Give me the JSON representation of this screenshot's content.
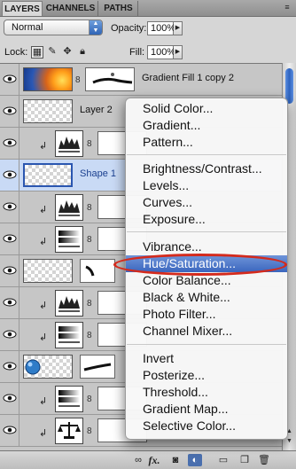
{
  "tabs": [
    {
      "label": "LAYERS",
      "active": true
    },
    {
      "label": "CHANNELS",
      "active": false
    },
    {
      "label": "PATHS",
      "active": false
    }
  ],
  "blend_mode": "Normal",
  "opacity": {
    "label": "Opacity:",
    "value": "100%"
  },
  "lock": {
    "label": "Lock:"
  },
  "fill": {
    "label": "Fill:",
    "value": "100%"
  },
  "layers": [
    {
      "type": "gradient-fill",
      "name": "Gradient Fill 1 copy 2"
    },
    {
      "type": "raster",
      "name": "Layer 2"
    },
    {
      "type": "adjustment",
      "name": ""
    },
    {
      "type": "shape",
      "name": "Shape 1",
      "selected": true
    },
    {
      "type": "adjustment",
      "name": ""
    },
    {
      "type": "adjustment",
      "name": ""
    },
    {
      "type": "raster",
      "name": ""
    },
    {
      "type": "adjustment",
      "name": ""
    },
    {
      "type": "adjustment",
      "name": ""
    },
    {
      "type": "raster",
      "name": ""
    },
    {
      "type": "adjustment",
      "name": ""
    },
    {
      "type": "adjustment",
      "name": ""
    }
  ],
  "menu": {
    "groups": [
      [
        "Solid Color...",
        "Gradient...",
        "Pattern..."
      ],
      [
        "Brightness/Contrast...",
        "Levels...",
        "Curves...",
        "Exposure..."
      ],
      [
        "Vibrance...",
        "Hue/Saturation...",
        "Color Balance...",
        "Black & White...",
        "Photo Filter...",
        "Channel Mixer..."
      ],
      [
        "Invert",
        "Posterize...",
        "Threshold...",
        "Gradient Map...",
        "Selective Color..."
      ]
    ],
    "highlighted": "Hue/Saturation..."
  },
  "bottom_bar": {
    "fx_label": "fx."
  },
  "colors": {
    "highlight": "#3b66be",
    "annotation": "#d42a1c",
    "selected_row": "#c9daf5"
  }
}
